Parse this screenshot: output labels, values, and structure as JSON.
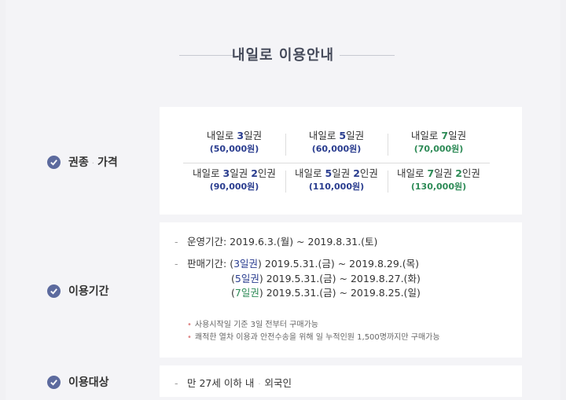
{
  "title": "내일로 이용안내",
  "sections": {
    "ticket": {
      "label_a": "권종",
      "label_sep": "·",
      "label_b": "가격"
    },
    "period": {
      "label": "이용기간"
    },
    "target": {
      "label": "이용대상"
    }
  },
  "tickets": [
    {
      "pre": "내일로 ",
      "num": "3",
      "post": "일권",
      "price": "(50,000원)"
    },
    {
      "pre": "내일로 ",
      "num": "5",
      "post": "일권",
      "price": "(60,000원)"
    },
    {
      "pre": "내일로 ",
      "num": "7",
      "post": "일권",
      "price": "(70,000원)"
    },
    {
      "pre": "내일로 ",
      "num": "3",
      "post": "일권 ",
      "num2": "2",
      "post2": "인권",
      "price": "(90,000원)"
    },
    {
      "pre": "내일로 ",
      "num": "5",
      "post": "일권 ",
      "num2": "2",
      "post2": "인권",
      "price": "(110,000원)"
    },
    {
      "pre": "내일로 ",
      "num": "7",
      "post": "일권 ",
      "num2": "2",
      "post2": "인권",
      "price": "(130,000원)"
    }
  ],
  "period": {
    "operation": "운영기간: 2019.6.3.(월) ~ 2019.8.31.(토)",
    "sale_label": "판매기간: ",
    "sales": [
      {
        "open": "(",
        "tag": "3일권",
        "close": ")",
        "range": " 2019.5.31.(금) ~ 2019.8.29.(목)"
      },
      {
        "open": "(",
        "tag": "5일권",
        "close": ")",
        "range": " 2019.5.31.(금) ~ 2019.8.27.(화)"
      },
      {
        "open": "(",
        "tag": "7일권",
        "close": ")",
        "range": " 2019.5.31.(금) ~ 2019.8.25.(일)"
      }
    ],
    "notes": [
      "사용시작일 기준 3일 전부터 구매가능",
      "쾌적한 열차 이용과 안전수송을 위해 일 누적인원 1,500명까지만 구매가능"
    ]
  },
  "target": {
    "a": "만 27세 이하 내",
    "sep": "·",
    "b": "외국인"
  },
  "colors": {
    "blue": "#2a3d8f",
    "green": "#2e8b57",
    "check": "#5c6a9e"
  }
}
